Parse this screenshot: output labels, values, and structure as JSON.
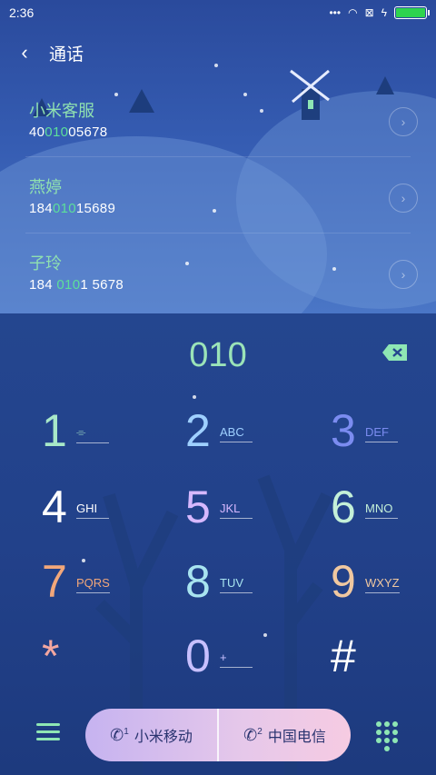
{
  "status": {
    "time": "2:36",
    "icons": [
      "dots-icon",
      "wifi-icon",
      "sim-x-icon",
      "charging-icon",
      "battery-icon"
    ]
  },
  "header": {
    "back": "‹",
    "title": "通话"
  },
  "contacts": [
    {
      "name": "小米客服",
      "num_pre": "40",
      "num_hl": "010",
      "num_post": "05678"
    },
    {
      "name": "燕婷",
      "num_pre": "184",
      "num_hl": "010",
      "num_post": "15689"
    },
    {
      "name": "子玲",
      "num_pre": "184 ",
      "num_hl": "010",
      "num_post": "1 5678"
    }
  ],
  "dial": {
    "value": "010"
  },
  "keys": [
    {
      "digit": "1",
      "letters": "",
      "color": "#a8e8c8"
    },
    {
      "digit": "2",
      "letters": "ABC",
      "color": "#9fd0ff"
    },
    {
      "digit": "3",
      "letters": "DEF",
      "color": "#7b8cf0"
    },
    {
      "digit": "4",
      "letters": "GHI",
      "color": "#ffffff"
    },
    {
      "digit": "5",
      "letters": "JKL",
      "color": "#d6b8ff"
    },
    {
      "digit": "6",
      "letters": "MNO",
      "color": "#c4f0d8"
    },
    {
      "digit": "7",
      "letters": "PQRS",
      "color": "#f2a77a"
    },
    {
      "digit": "8",
      "letters": "TUV",
      "color": "#a8e4f0"
    },
    {
      "digit": "9",
      "letters": "WXYZ",
      "color": "#f0c8a0"
    },
    {
      "digit": "*",
      "letters": "",
      "color": "#f3a7a0"
    },
    {
      "digit": "0",
      "letters": "+",
      "color": "#c8c0ff"
    },
    {
      "digit": "#",
      "letters": "",
      "color": "#ffffff"
    }
  ],
  "sims": [
    {
      "num": "1",
      "label": "小米移动"
    },
    {
      "num": "2",
      "label": "中国电信"
    }
  ],
  "colors": {
    "accent": "#8ee6b4",
    "highlight": "#5ddf9a",
    "battery": "#2ed44e"
  }
}
